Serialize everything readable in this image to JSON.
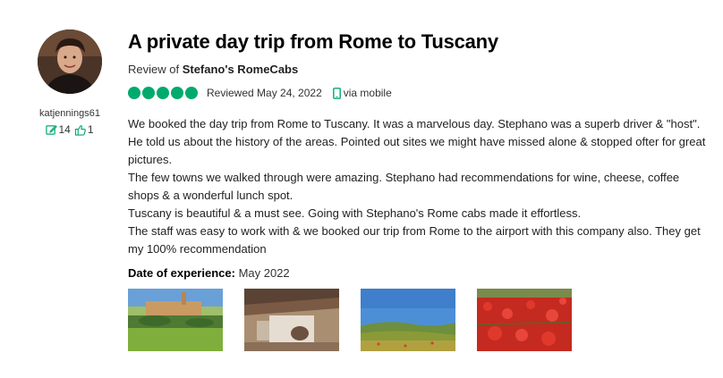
{
  "reviewer": {
    "username": "katjennings61",
    "contributions": "14",
    "helpful_votes": "1"
  },
  "review": {
    "title": "A private day trip from Rome to Tuscany",
    "review_of_prefix": "Review of",
    "business_name": "Stefano's RomeCabs",
    "rating": 5,
    "reviewed_date": "Reviewed May 24, 2022",
    "device": "via mobile",
    "body": [
      "We booked the day trip from Rome to Tuscany. It was a marvelous day. Stephano was a superb driver & \"host\". He told us about the history of the areas. Pointed out sites we might have missed alone & stopped ofter for great pictures.",
      "The few towns we walked through were amazing. Stephano had recommendations for wine, cheese, coffee shops & a wonderful lunch spot.",
      "Tuscany is beautiful & a must see. Going with Stephano's Rome cabs made it effortless.",
      "The staff was easy to work with & we booked our trip from Rome to the airport with this company also. They get my 100% recommendation"
    ],
    "date_of_experience_label": "Date of experience:",
    "date_of_experience": "May 2022"
  },
  "colors": {
    "rating_green": "#00aa6c",
    "text": "#1f1f1f"
  },
  "icons": {
    "contributions": "pencil-edit-icon",
    "helpful": "thumbs-up-icon",
    "device": "mobile-phone-icon"
  }
}
